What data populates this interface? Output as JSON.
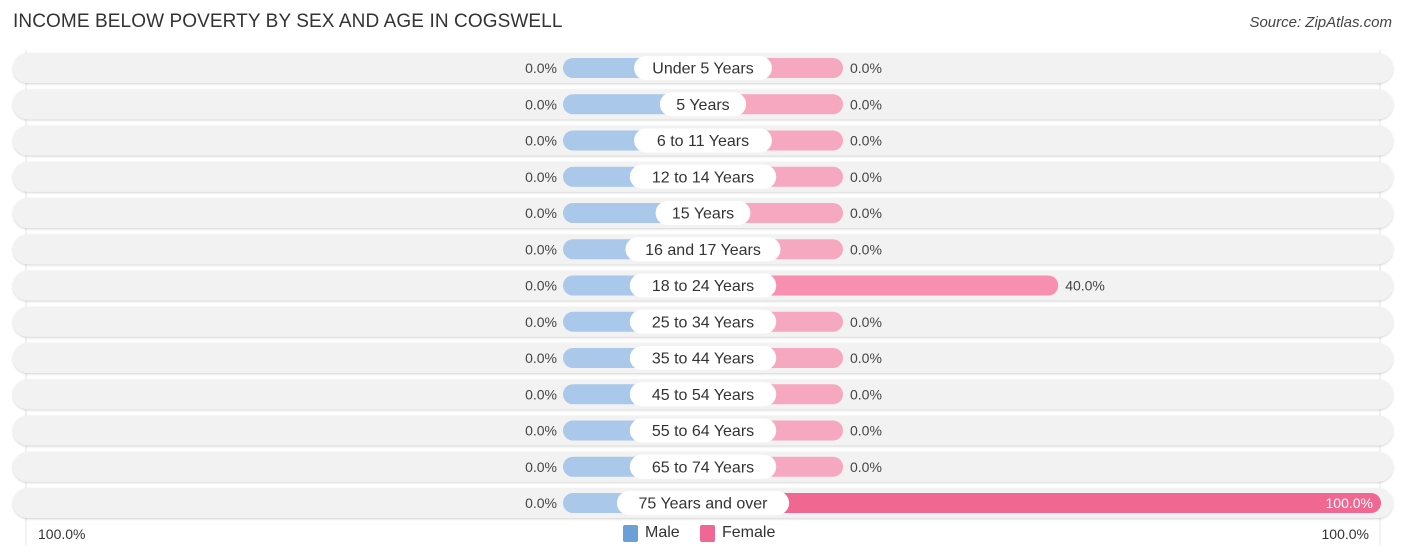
{
  "title": "INCOME BELOW POVERTY BY SEX AND AGE IN COGSWELL",
  "source": "Source: ZipAtlas.com",
  "colors": {
    "male": "#aac8ea",
    "female_light": "#f7a8c1",
    "female_medium": "#f78fb0",
    "female_strong": "#f06892",
    "row_bg": "#f2f2f2",
    "label_bg": "#ffffff",
    "legend_male": "#6a9fd8",
    "legend_female": "#f06892"
  },
  "axis": {
    "left_label": "100.0%",
    "right_label": "100.0%"
  },
  "legend": [
    {
      "name": "Male",
      "key": "male"
    },
    {
      "name": "Female",
      "key": "female"
    }
  ],
  "chart_data": {
    "type": "bar",
    "orientation": "horizontal-diverging",
    "title": "INCOME BELOW POVERTY BY SEX AND AGE IN COGSWELL",
    "xlabel": "",
    "ylabel": "",
    "xlim": [
      -100,
      100
    ],
    "unit": "%",
    "categories": [
      "Under 5 Years",
      "5 Years",
      "6 to 11 Years",
      "12 to 14 Years",
      "15 Years",
      "16 and 17 Years",
      "18 to 24 Years",
      "25 to 34 Years",
      "35 to 44 Years",
      "45 to 54 Years",
      "55 to 64 Years",
      "65 to 74 Years",
      "75 Years and over"
    ],
    "series": [
      {
        "name": "Male",
        "side": "left",
        "values": [
          0,
          0,
          0,
          0,
          0,
          0,
          0,
          0,
          0,
          0,
          0,
          0,
          0
        ],
        "labels": [
          "0.0%",
          "0.0%",
          "0.0%",
          "0.0%",
          "0.0%",
          "0.0%",
          "0.0%",
          "0.0%",
          "0.0%",
          "0.0%",
          "0.0%",
          "0.0%",
          "0.0%"
        ]
      },
      {
        "name": "Female",
        "side": "right",
        "values": [
          0,
          0,
          0,
          0,
          0,
          0,
          40,
          0,
          0,
          0,
          0,
          0,
          100
        ],
        "labels": [
          "0.0%",
          "0.0%",
          "0.0%",
          "0.0%",
          "0.0%",
          "0.0%",
          "40.0%",
          "0.0%",
          "0.0%",
          "0.0%",
          "0.0%",
          "0.0%",
          "100.0%"
        ]
      }
    ],
    "legend_position": "bottom-center",
    "grid": false
  }
}
